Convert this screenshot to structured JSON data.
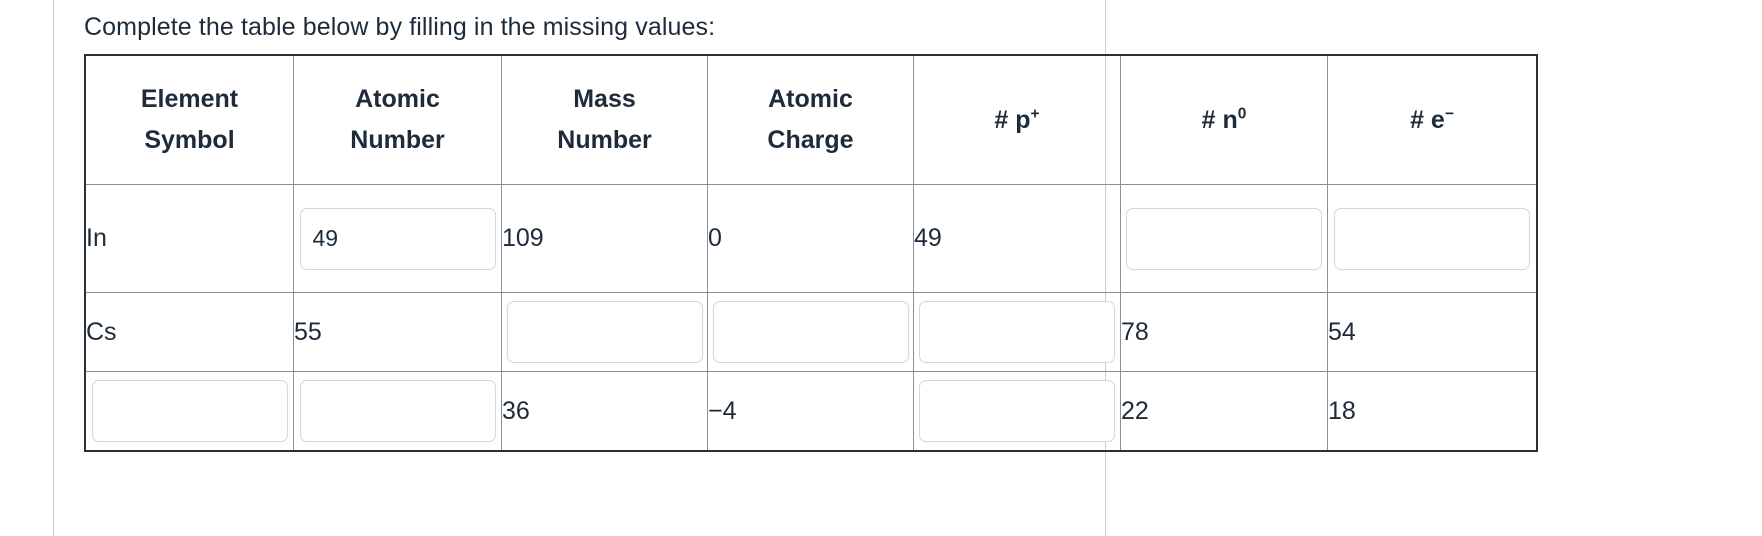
{
  "prompt": "Complete the table below by filling in the missing values:",
  "table": {
    "headers": [
      {
        "line1": "Element",
        "line2": "Symbol"
      },
      {
        "line1": "Atomic",
        "line2": "Number"
      },
      {
        "line1": "Mass",
        "line2": "Number"
      },
      {
        "line1": "Atomic",
        "line2": "Charge"
      },
      {
        "base": "# p",
        "sup": "+"
      },
      {
        "base": "# n",
        "sup": "0"
      },
      {
        "base": "# e",
        "sup": "−"
      }
    ],
    "rows": [
      {
        "element_symbol": "In",
        "atomic_number": "49",
        "mass_number": "109",
        "atomic_charge": "0",
        "protons": "49",
        "neutrons": "",
        "electrons": ""
      },
      {
        "element_symbol": "Cs",
        "atomic_number": "55",
        "mass_number": "",
        "atomic_charge": "",
        "protons": "",
        "neutrons": "78",
        "electrons": "54"
      },
      {
        "element_symbol": "",
        "atomic_number": "",
        "mass_number": "36",
        "atomic_charge": "−4",
        "protons": "",
        "neutrons": "22",
        "electrons": "18"
      }
    ]
  }
}
